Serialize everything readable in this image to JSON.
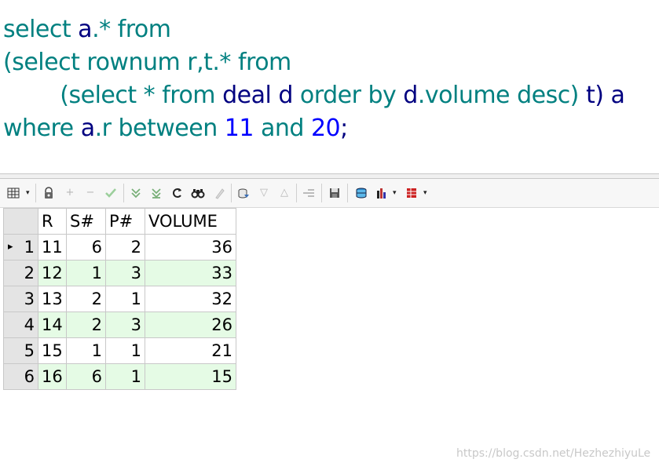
{
  "sql": {
    "line1": {
      "t1": "select ",
      "t2": "a",
      "t3": ".* ",
      "t4": "from"
    },
    "line2": {
      "t1": "(select ",
      "t2": "rownum ",
      "t3": "r,t",
      "t4": ".* ",
      "t5": "from"
    },
    "line3": {
      "t1": "        (select * from ",
      "t2": "deal ",
      "t3": "d ",
      "t4": "order by ",
      "t5": "d",
      "t6": ".volume ",
      "t7": "desc) ",
      "t8": "t) ",
      "t9": "a"
    },
    "line4": {
      "t1": "where ",
      "t2": "a",
      "t3": ".r ",
      "t4": "between ",
      "t5": "11 ",
      "t6": "and ",
      "t7": "20",
      "t8": ";"
    }
  },
  "toolbar": {
    "icons": [
      "grid-icon",
      "lock-icon",
      "add-record-icon",
      "delete-record-icon",
      "post-icon",
      "first-icon",
      "last-icon",
      "refresh-icon",
      "find-icon",
      "clear-icon",
      "export-icon",
      "query-by-example-icon",
      "previous-icon",
      "save-icon",
      "link-icon",
      "chart-icon",
      "table-icon"
    ]
  },
  "grid": {
    "columns": [
      "R",
      "S#",
      "P#",
      "VOLUME"
    ],
    "rows": [
      {
        "n": "1",
        "r": "11",
        "s": "6",
        "p": "2",
        "v": "36"
      },
      {
        "n": "2",
        "r": "12",
        "s": "1",
        "p": "3",
        "v": "33"
      },
      {
        "n": "3",
        "r": "13",
        "s": "2",
        "p": "1",
        "v": "32"
      },
      {
        "n": "4",
        "r": "14",
        "s": "2",
        "p": "3",
        "v": "26"
      },
      {
        "n": "5",
        "r": "15",
        "s": "1",
        "p": "1",
        "v": "21"
      },
      {
        "n": "6",
        "r": "16",
        "s": "6",
        "p": "1",
        "v": "15"
      }
    ],
    "current_row_indicator": "▸"
  },
  "watermark": "https://blog.csdn.net/HezhezhiyuLe",
  "colors": {
    "keyword": "#008080",
    "identifier": "#000080",
    "number": "#0000ff",
    "alt_row": "#e5fbe5"
  }
}
